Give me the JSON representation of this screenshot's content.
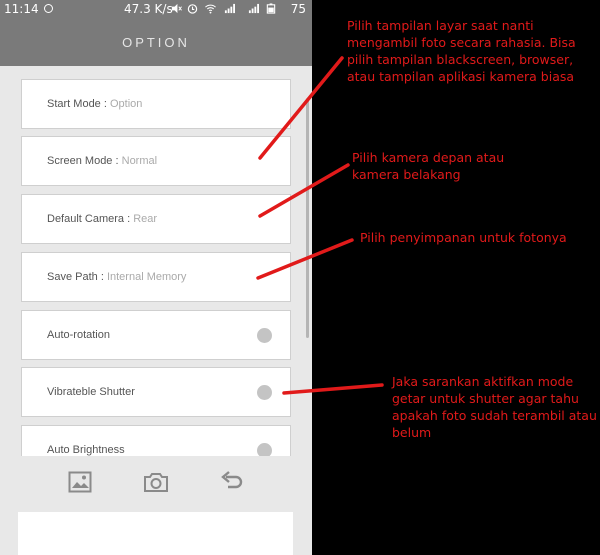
{
  "status_bar": {
    "time": "11:14",
    "speed": "47.3 K/s",
    "battery": "75"
  },
  "app_bar": {
    "title": "OPTION"
  },
  "options": [
    {
      "label": "Start Mode",
      "separator": ":",
      "value": "Option"
    },
    {
      "label": "Screen Mode",
      "separator": ":",
      "value": "Normal"
    },
    {
      "label": "Default Camera",
      "separator": ":",
      "value": "Rear"
    },
    {
      "label": "Save Path",
      "separator": ":",
      "value": "Internal Memory"
    },
    {
      "label": "Auto-rotation",
      "toggle": "off"
    },
    {
      "label": "Vibrateble Shutter",
      "toggle": "off"
    },
    {
      "label": "Auto Brightness",
      "toggle": "off"
    }
  ],
  "bottom_bar": {
    "icons": [
      "gallery-icon",
      "camera-icon",
      "back-icon"
    ]
  },
  "annotations": [
    "Pilih tampilan layar saat nanti mengambil foto secara rahasia. Bisa pilih tampilan blackscreen, browser, atau tampilan aplikasi kamera biasa",
    "Pilih kamera depan atau kamera belakang",
    "Pilih penyimpanan untuk fotonya",
    "Jaka sarankan aktifkan mode getar untuk shutter agar tahu apakah foto sudah terambil atau belum"
  ],
  "colors": {
    "app_bar": "#7a7a7a",
    "background": "#e8e8e8",
    "annotation": "#e11a1a",
    "toggle_off": "#c4c4c4"
  }
}
